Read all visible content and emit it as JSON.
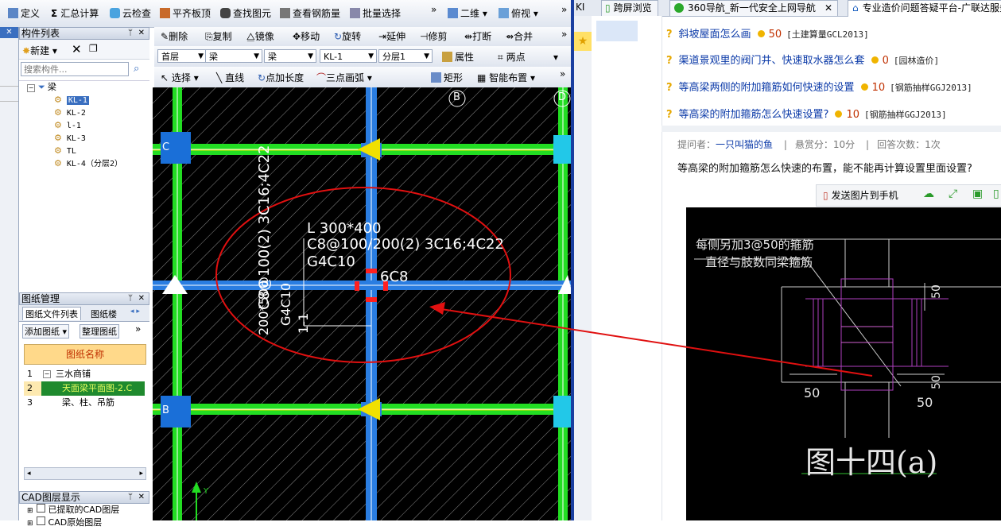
{
  "toolbar1": {
    "define": "定义",
    "sum": "汇总计算",
    "cloud": "云检查",
    "slab": "平齐板顶",
    "find": "查找图元",
    "view_rebar": "查看钢筋量",
    "batch": "批量选择",
    "mode": "二维",
    "view": "俯视",
    "more": "»"
  },
  "comp_list": {
    "title": "构件列表",
    "new": "新建",
    "search_placeholder": "搜索构件...",
    "root": "梁",
    "items": [
      "KL-1",
      "KL-2",
      "l-1",
      "KL-3",
      "TL",
      "KL-4（分层2）"
    ],
    "selected": "KL-1"
  },
  "toolbar2": {
    "delete": "删除",
    "copy": "复制",
    "mirror": "镜像",
    "move": "移动",
    "rotate": "旋转",
    "extend": "延伸",
    "trim": "修剪",
    "break": "打断",
    "merge": "合并"
  },
  "toolbar3": {
    "floor": "首层",
    "type1": "梁",
    "type2": "梁",
    "comp": "KL-1",
    "layer": "分层1",
    "attr": "属性",
    "twopoint": "两点"
  },
  "toolbar4": {
    "select": "选择",
    "line": "直线",
    "point_len": "点加长度",
    "arc": "三点画弧",
    "rect": "矩形",
    "smart": "智能布置"
  },
  "drawing_mgr": {
    "title": "图纸管理",
    "tab1": "图纸文件列表",
    "tab2": "图纸楼",
    "add": "添加图纸",
    "arrange": "整理图纸",
    "col_header": "图纸名称",
    "rows": [
      {
        "n": "1",
        "name": "三水商铺"
      },
      {
        "n": "2",
        "name": "天面梁平面图-2.C"
      },
      {
        "n": "3",
        "name": "梁、柱、吊筋"
      }
    ]
  },
  "cad_layer": {
    "title": "CAD图层显示",
    "item1": "已提取的CAD图层",
    "item2": "CAD原始图层"
  },
  "cad_canvas": {
    "axis_b_top": "B",
    "axis_d": "D",
    "axis_c": "C",
    "axis_b_left": "B",
    "t1": "L 300*400",
    "t2": "C8@100/200(2) 3C16;4C22",
    "t3": "G4C10",
    "t4": "6C8",
    "t5": "C8@100(2) 3C16;4C22",
    "t6": "G4C10",
    "t7": "1-1",
    "t8": "200*500",
    "y_axis": "Y"
  },
  "browser": {
    "tab_frag": "KI",
    "tab1": "跨屏浏览",
    "tab2": "360导航_新一代安全上网导航",
    "tab3": "专业造价问题答疑平台-广联达服务"
  },
  "questions": [
    {
      "title": "斜坡屋面怎么画",
      "score": "50",
      "tag": "[土建算量GCL2013]"
    },
    {
      "title": "渠道景观里的阀门井、快速取水器怎么套",
      "score": "0",
      "tag": "[园林造价]"
    },
    {
      "title": "等高梁两侧的附加箍筋如何快速的设置",
      "score": "10",
      "tag": "[钢筋抽样GGJ2013]"
    },
    {
      "title": "等高梁的附加箍筋怎么快速设置?",
      "score": "10",
      "tag": "[钢筋抽样GGJ2013]"
    }
  ],
  "q_meta": {
    "asker_label": "提问者：",
    "asker": "一只叫猫的鱼",
    "sep": "|",
    "reward": "悬赏分：10分",
    "answers": "回答次数：1次"
  },
  "q_body": "等高梁的附加箍筋怎么快速的布置，能不能再计算设置里面设置?",
  "send_btn": "发送图片到手机",
  "cad_image": {
    "note1": "每侧另加3@50的箍筋",
    "note2": "直径与肢数同梁箍筋",
    "d1": "50",
    "d2": "50",
    "d3": "50",
    "d4": "50",
    "caption": "图十四(a)"
  },
  "colors": {
    "cad_bg": "#000000",
    "beam_green": "#22dd22",
    "beam_blue": "#2a7de1",
    "annot_red": "#e01010",
    "link_blue": "#0b3aa8"
  }
}
